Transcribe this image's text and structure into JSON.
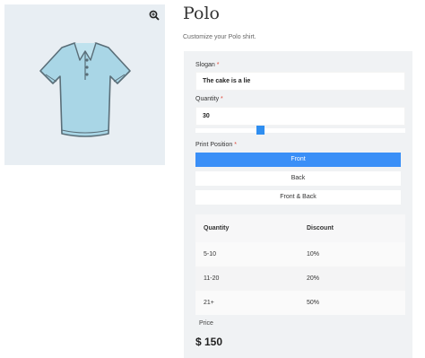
{
  "product": {
    "title": "Polo",
    "subtitle": "Customize your Polo shirt.",
    "image_icon": "polo-shirt",
    "zoom_icon": "zoom-in-icon"
  },
  "form": {
    "slogan": {
      "label": "Slogan",
      "required_mark": "*",
      "value": "The cake is a lie"
    },
    "quantity": {
      "label": "Quantity",
      "required_mark": "*",
      "value": "30",
      "slider_fraction": 0.3
    },
    "print_position": {
      "label": "Print Position",
      "required_mark": "*",
      "options": [
        "Front",
        "Back",
        "Front & Back"
      ],
      "selected": "Front"
    }
  },
  "discount_table": {
    "headers": [
      "Quantity",
      "Discount"
    ],
    "rows": [
      [
        "5-10",
        "10%"
      ],
      [
        "11-20",
        "20%"
      ],
      [
        "21+",
        "50%"
      ]
    ]
  },
  "price": {
    "label": "Price",
    "value": "$ 150"
  },
  "colors": {
    "accent": "#3a8ff7",
    "required": "#e04a3a",
    "shirt": "#a9d6e6"
  }
}
